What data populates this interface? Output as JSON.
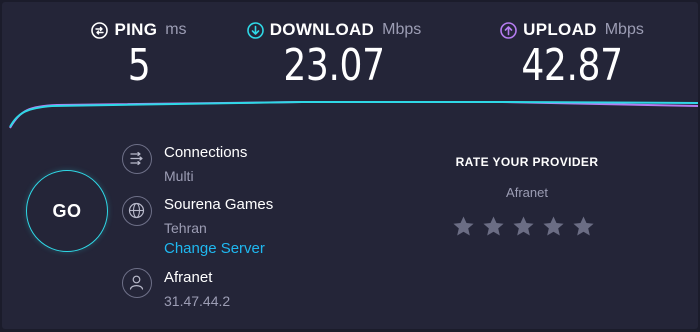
{
  "metrics": {
    "ping": {
      "label": "PING",
      "unit": "ms",
      "value": "5",
      "icon": "ping-icon",
      "color": "#ffffff"
    },
    "download": {
      "label": "DOWNLOAD",
      "unit": "Mbps",
      "value": "23.07",
      "icon": "download-arrow-icon",
      "color": "#2fd8e6"
    },
    "upload": {
      "label": "UPLOAD",
      "unit": "Mbps",
      "value": "42.87",
      "icon": "upload-arrow-icon",
      "color": "#b57cf0"
    }
  },
  "go_button": {
    "label": "GO",
    "color": "#2fd8e6"
  },
  "connections": {
    "title": "Connections",
    "value": "Multi",
    "icon": "connections-icon"
  },
  "server": {
    "name": "Sourena Games",
    "location": "Tehran",
    "change_label": "Change Server",
    "icon": "globe-icon"
  },
  "provider": {
    "name": "Afranet",
    "ip": "31.47.44.2",
    "icon": "user-icon"
  },
  "rating": {
    "title": "RATE YOUR PROVIDER",
    "isp": "Afranet",
    "stars": 5,
    "selected": 0
  },
  "colors": {
    "background": "#242538",
    "accent_download": "#2fd8e6",
    "accent_upload": "#b57cf0",
    "link": "#1fb8f0",
    "star_empty": "#6b6d84"
  }
}
